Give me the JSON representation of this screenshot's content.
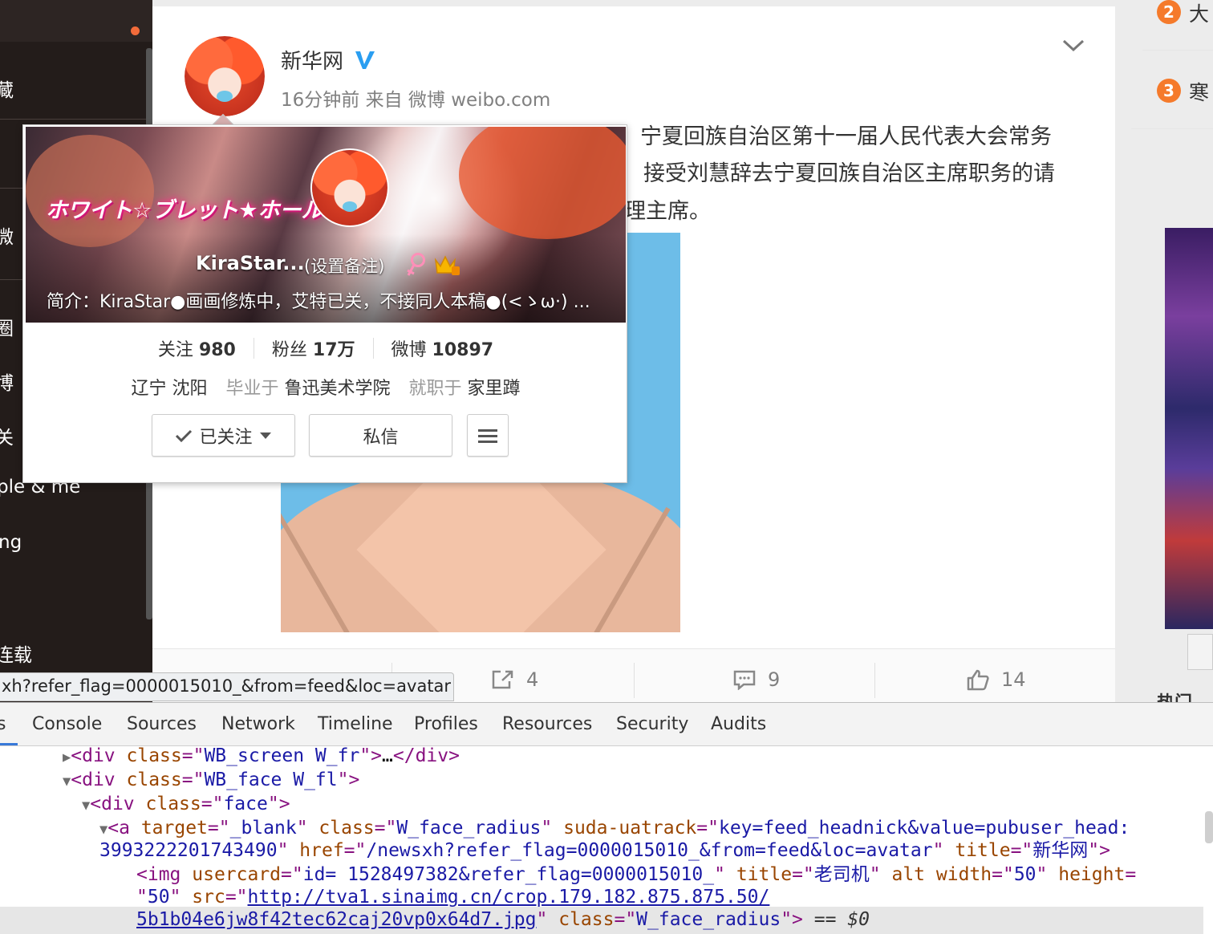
{
  "sidebar": {
    "items": [
      "藏",
      "微",
      "圈",
      "博",
      "关",
      "ple & me",
      "ng",
      "连载"
    ]
  },
  "right_column": {
    "hot": [
      {
        "rank": "2",
        "text": "大"
      },
      {
        "rank": "3",
        "text": "寒"
      }
    ],
    "bottom_text": "热门"
  },
  "feed": {
    "author": "新华网",
    "meta": "16分钟前 来自 微博 weibo.com",
    "lines": [
      "宁夏回族自治区第十一届人民代表大会常务",
      "接受刘慧辞去宁夏回族自治区主席职务的请",
      "理主席。"
    ],
    "actions": {
      "forward_count": "4",
      "comment_count": "9",
      "like_count": "14"
    }
  },
  "status_url": "xh?refer_flag=0000015010_&from=feed&loc=avatar",
  "usercard": {
    "cover_title": "ホワイト☆ブレット★ホール",
    "name": "KiraStar...",
    "remark": "(设置备注)",
    "bio": "简介：KiraStar●画画修炼中，艾特已关，不接同人本稿●(<ゝω·) ...",
    "stats": [
      {
        "label": "关注",
        "value": "980"
      },
      {
        "label": "粉丝",
        "value": "17万"
      },
      {
        "label": "微博",
        "value": "10897"
      }
    ],
    "location": "辽宁 沈阳",
    "school_label": "毕业于",
    "school": "鲁迅美术学院",
    "job_label": "就职于",
    "job": "家里蹲",
    "follow_button": "已关注",
    "message_button": "私信"
  },
  "devtools": {
    "tabs": [
      "s",
      "Console",
      "Sources",
      "Network",
      "Timeline",
      "Profiles",
      "Resources",
      "Security",
      "Audits"
    ],
    "code": {
      "l1_class": "WB_screen W_fr",
      "l2_class": "WB_face W_fl",
      "l3_class": "face",
      "l4_target": "_blank",
      "l4_class": "W_face_radius",
      "l4_suda": "key=feed_headnick&value=pubuser_head:",
      "l5_suda_cont": "3993222201743490",
      "l5_href": "/newsxh?refer_flag=0000015010_&from=feed&loc=avatar",
      "l5_title": "新华网",
      "l6_usercard": "id= 1528497382&refer_flag=0000015010_",
      "l6_title": "老司机",
      "l6_width": "50",
      "l7_height": "50",
      "l7_src": "http://tva1.sinaimg.cn/crop.179.182.875.875.50/",
      "l8_src_cont": "5b1b04e6jw8f42tec62caj20vp0x64d7.jpg",
      "l8_class": "W_face_radius",
      "l8_suffix": "$0"
    }
  },
  "colors": {
    "accent_orange": "#f57a2b",
    "verified_blue": "#2a9ef1",
    "sidebar_bg": "#231c1a"
  }
}
